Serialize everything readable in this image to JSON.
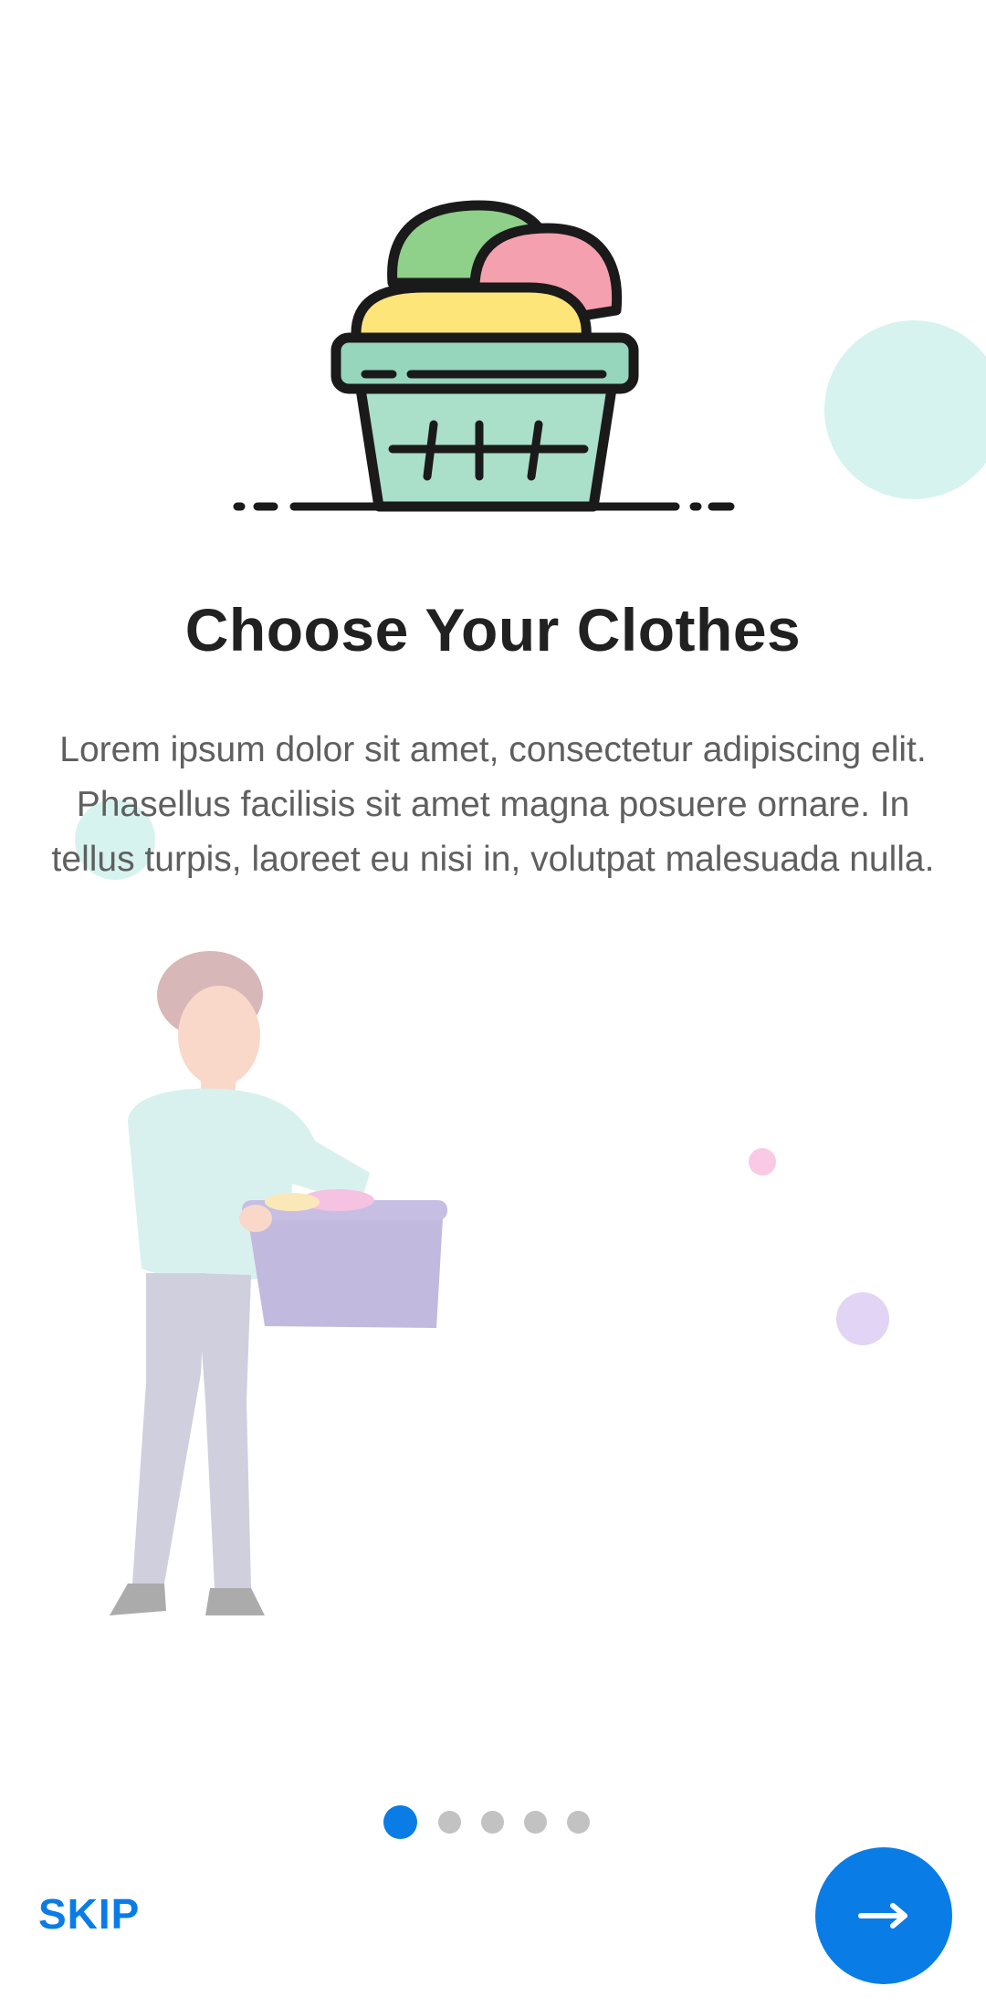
{
  "onboarding": {
    "title": "Choose Your Clothes",
    "description": "Lorem ipsum dolor sit amet, consectetur adipiscing elit. Phasellus facilisis sit amet magna posuere ornare. In tellus turpis, laoreet eu nisi in, volutpat malesuada nulla.",
    "illustration_icon": "laundry-basket-icon",
    "background_illustration": "person-carrying-basket"
  },
  "pagination": {
    "total_pages": 5,
    "current_page": 1
  },
  "actions": {
    "skip_label": "SKIP",
    "next_icon": "arrow-right-icon"
  },
  "colors": {
    "accent": "#0a7ce6",
    "inactive_dot": "#c2c2c2",
    "title": "#212121",
    "body_text": "#5f5f5f"
  }
}
